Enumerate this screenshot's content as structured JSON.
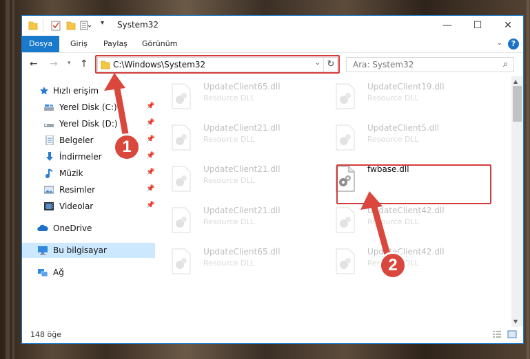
{
  "window": {
    "title": "System32",
    "controls": {
      "minimize": "—",
      "maximize": "☐",
      "close": "✕"
    }
  },
  "ribbon": {
    "tabs": [
      "Dosya",
      "Giriş",
      "Paylaş",
      "Görünüm"
    ],
    "help": "?"
  },
  "address": {
    "path": "C:\\Windows\\System32",
    "search_placeholder": "Ara: System32"
  },
  "sidebar": {
    "items": [
      {
        "label": "Hızlı erişim",
        "icon": "star-icon",
        "pinned": false
      },
      {
        "label": "Yerel Disk (C:)",
        "icon": "drive-icon",
        "pinned": true
      },
      {
        "label": "Yerel Disk (D:)",
        "icon": "drive-icon",
        "pinned": true
      },
      {
        "label": "Belgeler",
        "icon": "documents-icon",
        "pinned": true
      },
      {
        "label": "İndirmeler",
        "icon": "download-icon",
        "pinned": true
      },
      {
        "label": "Müzik",
        "icon": "music-icon",
        "pinned": true
      },
      {
        "label": "Resimler",
        "icon": "pictures-icon",
        "pinned": true
      },
      {
        "label": "Videolar",
        "icon": "videos-icon",
        "pinned": true
      },
      {
        "label": "OneDrive",
        "icon": "cloud-icon",
        "pinned": false
      },
      {
        "label": "Bu bilgisayar",
        "icon": "computer-icon",
        "pinned": false
      },
      {
        "label": "Ağ",
        "icon": "network-icon",
        "pinned": false
      }
    ]
  },
  "files": [
    {
      "name": "UpdateClient65.dll",
      "type": "Resource DLL"
    },
    {
      "name": "UpdateClient19.dll",
      "type": "Resource DLL"
    },
    {
      "name": "UpdateClient21.dll",
      "type": "Resource DLL"
    },
    {
      "name": "UpdateClient5.dll",
      "type": "Resource DLL"
    },
    {
      "name": "UpdateClient21.dll",
      "type": "Resource DLL"
    },
    {
      "name": "fwbase.dll",
      "type": ""
    },
    {
      "name": "UpdateClient21.dll",
      "type": "Resource DLL"
    },
    {
      "name": "UpdateClient42.dll",
      "type": "Resource DLL"
    },
    {
      "name": "UpdateClient65.dll",
      "type": "Resource DLL"
    },
    {
      "name": "UpdateClient42.dll",
      "type": "Resource DLL"
    }
  ],
  "status": {
    "count": "148 öğe"
  },
  "annotations": {
    "step1": "1",
    "step2": "2"
  },
  "colors": {
    "accent": "#1979ca",
    "highlight": "#d23b3b",
    "selected": "#cce8ff"
  }
}
